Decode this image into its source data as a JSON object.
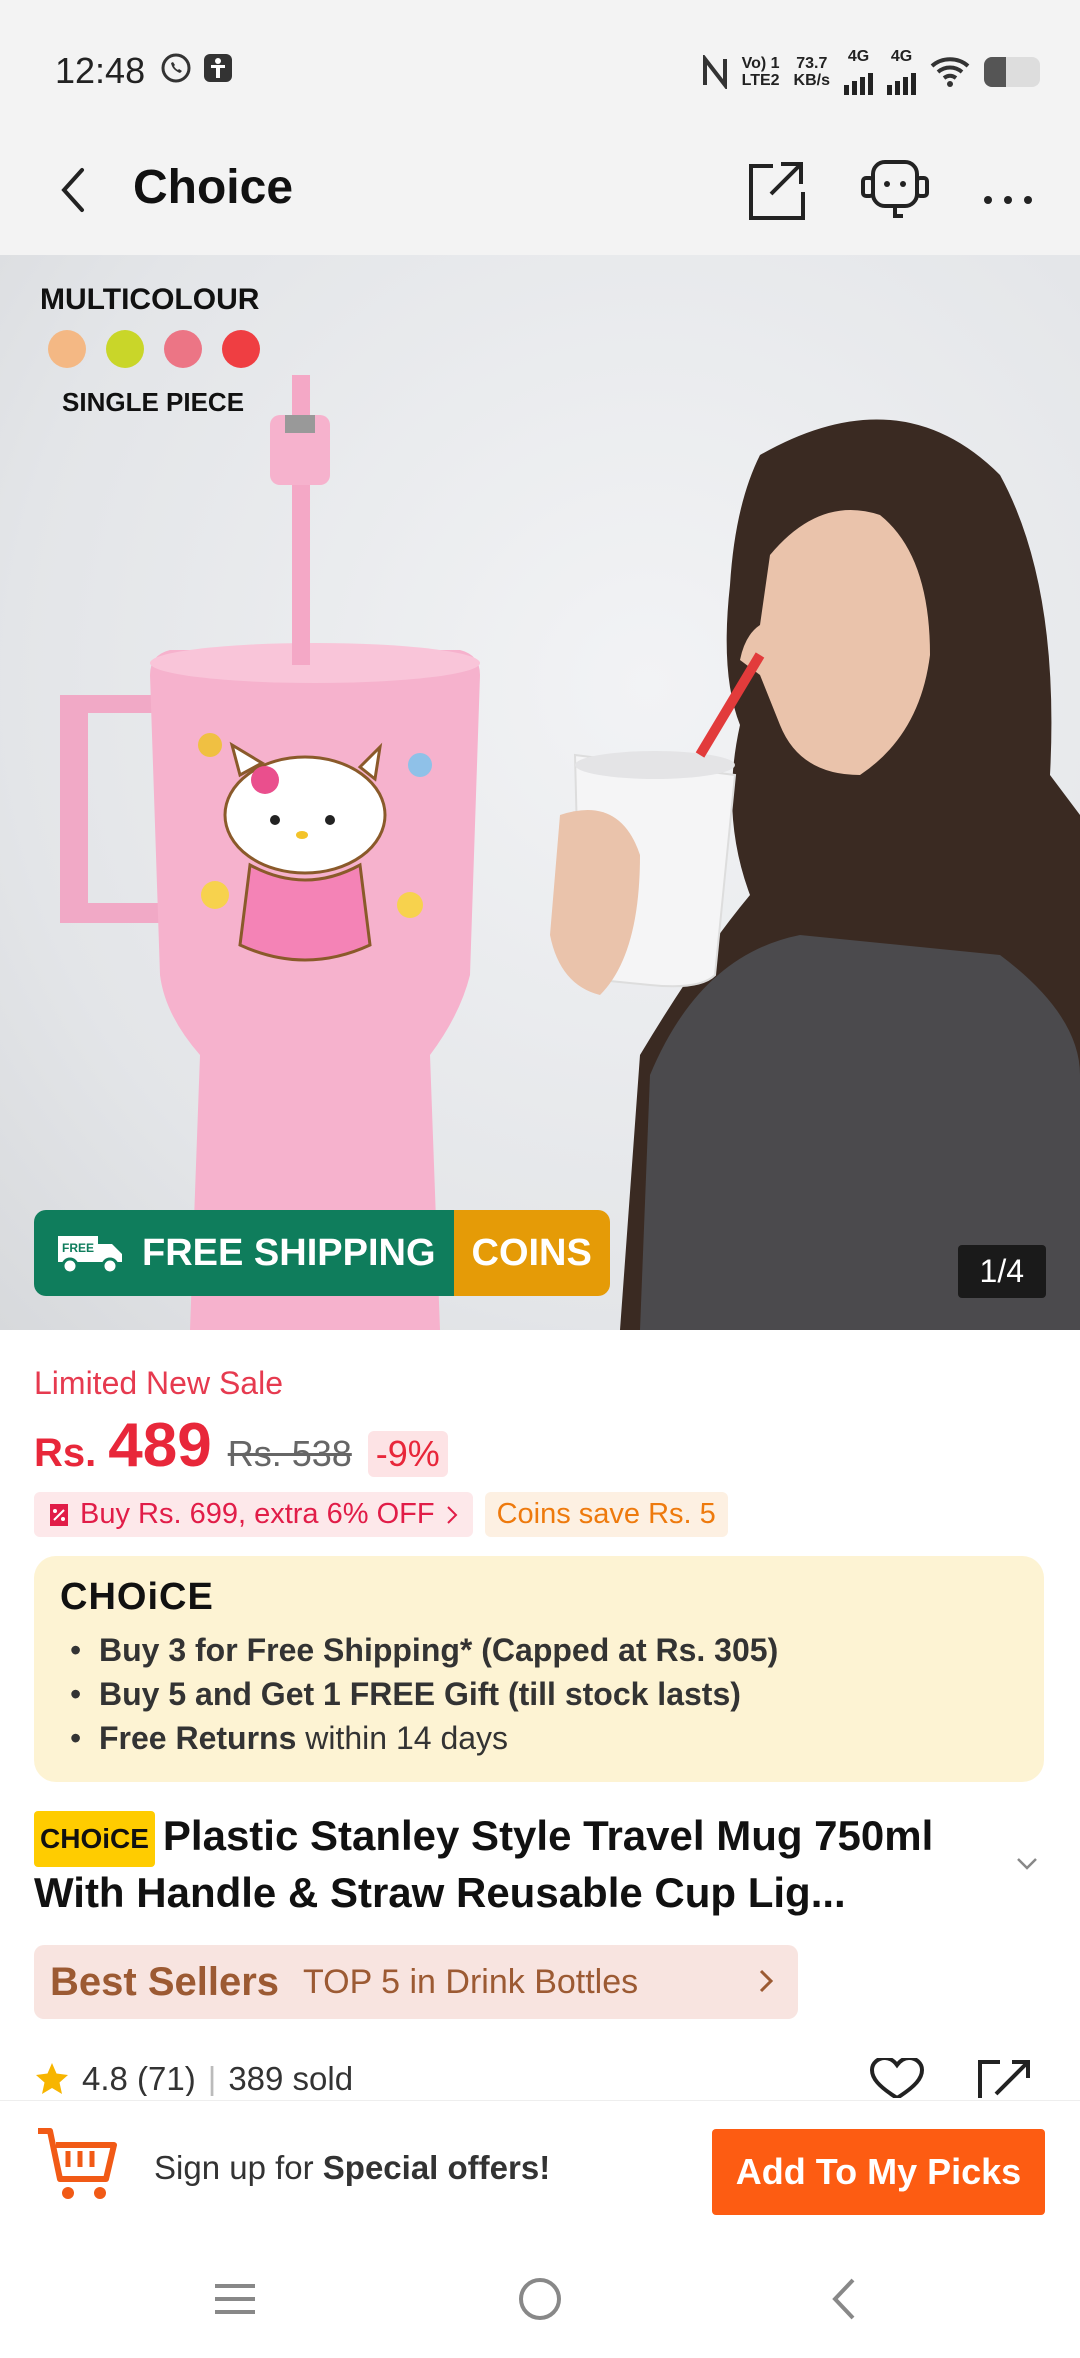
{
  "status_bar": {
    "time": "12:48",
    "net_line1": "Vo) 1",
    "net_line2": "LTE2",
    "speed_line1": "73.7",
    "speed_line2": "KB/s",
    "sig1_label": "4G",
    "sig2_label": "4G",
    "battery_level": 0.4
  },
  "header": {
    "title": "Choice"
  },
  "hero": {
    "multicolour": "MULTICOLOUR",
    "single_piece": "SINGLE PIECE",
    "swatches": [
      "#f4b884",
      "#c9d629",
      "#ec7585",
      "#ef3e42"
    ],
    "free_badge": "FREE",
    "free_shipping": "FREE SHIPPING",
    "coins": "COINS",
    "counter": "1/4"
  },
  "price": {
    "limited": "Limited New Sale",
    "currency": "Rs.",
    "amount": "489",
    "old": "Rs. 538",
    "discount": "-9%",
    "promo1": "Buy Rs. 699, extra 6% OFF",
    "promo2": "Coins save Rs. 5"
  },
  "choice_box": {
    "logo": "CHOiCE",
    "b1": "Buy 3 for  Free Shipping* (Capped at Rs. 305)",
    "b2": "Buy 5 and Get 1 FREE Gift (till stock lasts)",
    "b3_bold": "Free Returns",
    "b3_rest": " within 14 days"
  },
  "product": {
    "tag": "CHOiCE",
    "title": "Plastic Stanley Style Travel Mug 750ml With Handle & Straw Reusable Cup Lig..."
  },
  "best_sellers": {
    "logo": "Best Sellers",
    "text": "TOP 5 in Drink Bottles"
  },
  "rating": {
    "score": "4.8 (71)",
    "sold": "389 sold"
  },
  "bottom": {
    "signup_pre": "Sign up for ",
    "signup_bold": "Special offers!",
    "button": "Add To My Picks"
  },
  "colors": {
    "accent_red": "#e8273a",
    "cta_orange": "#fd5c12",
    "ship_green": "#0f7d5c",
    "coins_orange": "#e59b07"
  }
}
